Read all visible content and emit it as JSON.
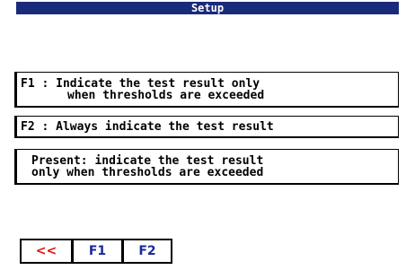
{
  "title": "Setup",
  "options": {
    "f1": {
      "line1": "F1 : Indicate the test result only",
      "line2": "when thresholds are exceeded"
    },
    "f2": {
      "line1": "F2 : Always indicate the test result"
    },
    "present": {
      "line1": "Present: indicate the test result",
      "line2": "only when thresholds are exceeded"
    }
  },
  "toolbar": {
    "back_label": "<<",
    "f1_label": "F1",
    "f2_label": "F2"
  },
  "colors": {
    "titlebar": "#1a2a7a",
    "back_button_text": "#e01010",
    "function_key_text": "#1a2a9a"
  }
}
